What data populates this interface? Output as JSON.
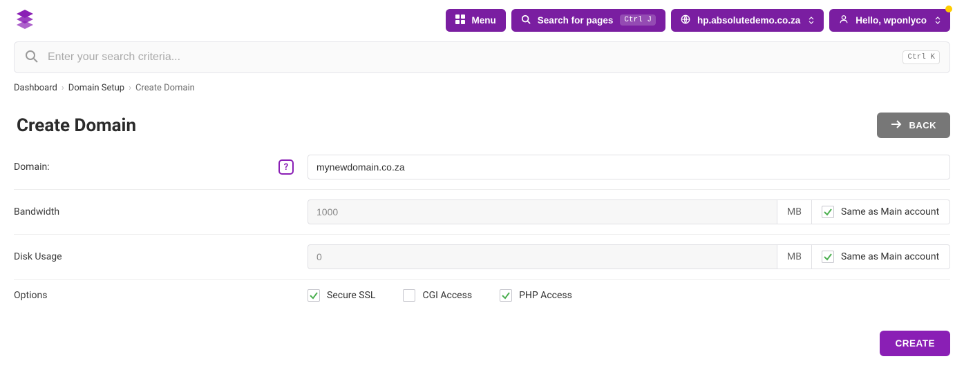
{
  "colors": {
    "accent": "#8a1fb5",
    "topbar_pill": "#7a1ea1",
    "back_btn": "#777"
  },
  "topbar": {
    "menu_label": "Menu",
    "search_pages_label": "Search for pages",
    "search_pages_kbd": "Ctrl J",
    "site_label": "hp.absolutedemo.co.za",
    "user_label": "Hello, wponlyco"
  },
  "search": {
    "placeholder": "Enter your search criteria...",
    "kbd": "Ctrl K"
  },
  "breadcrumb": {
    "items": [
      "Dashboard",
      "Domain Setup",
      "Create Domain"
    ]
  },
  "page": {
    "title": "Create Domain",
    "back_label": "BACK",
    "create_label": "CREATE"
  },
  "form": {
    "domain": {
      "label": "Domain:",
      "value": "mynewdomain.co.za"
    },
    "bandwidth": {
      "label": "Bandwidth",
      "value": "1000",
      "unit": "MB",
      "same_label": "Same as Main account",
      "same_checked": true
    },
    "disk": {
      "label": "Disk Usage",
      "value": "0",
      "unit": "MB",
      "same_label": "Same as Main account",
      "same_checked": true
    },
    "options": {
      "label": "Options",
      "secure_ssl": {
        "label": "Secure SSL",
        "checked": true
      },
      "cgi_access": {
        "label": "CGI Access",
        "checked": false
      },
      "php_access": {
        "label": "PHP Access",
        "checked": true
      }
    }
  }
}
